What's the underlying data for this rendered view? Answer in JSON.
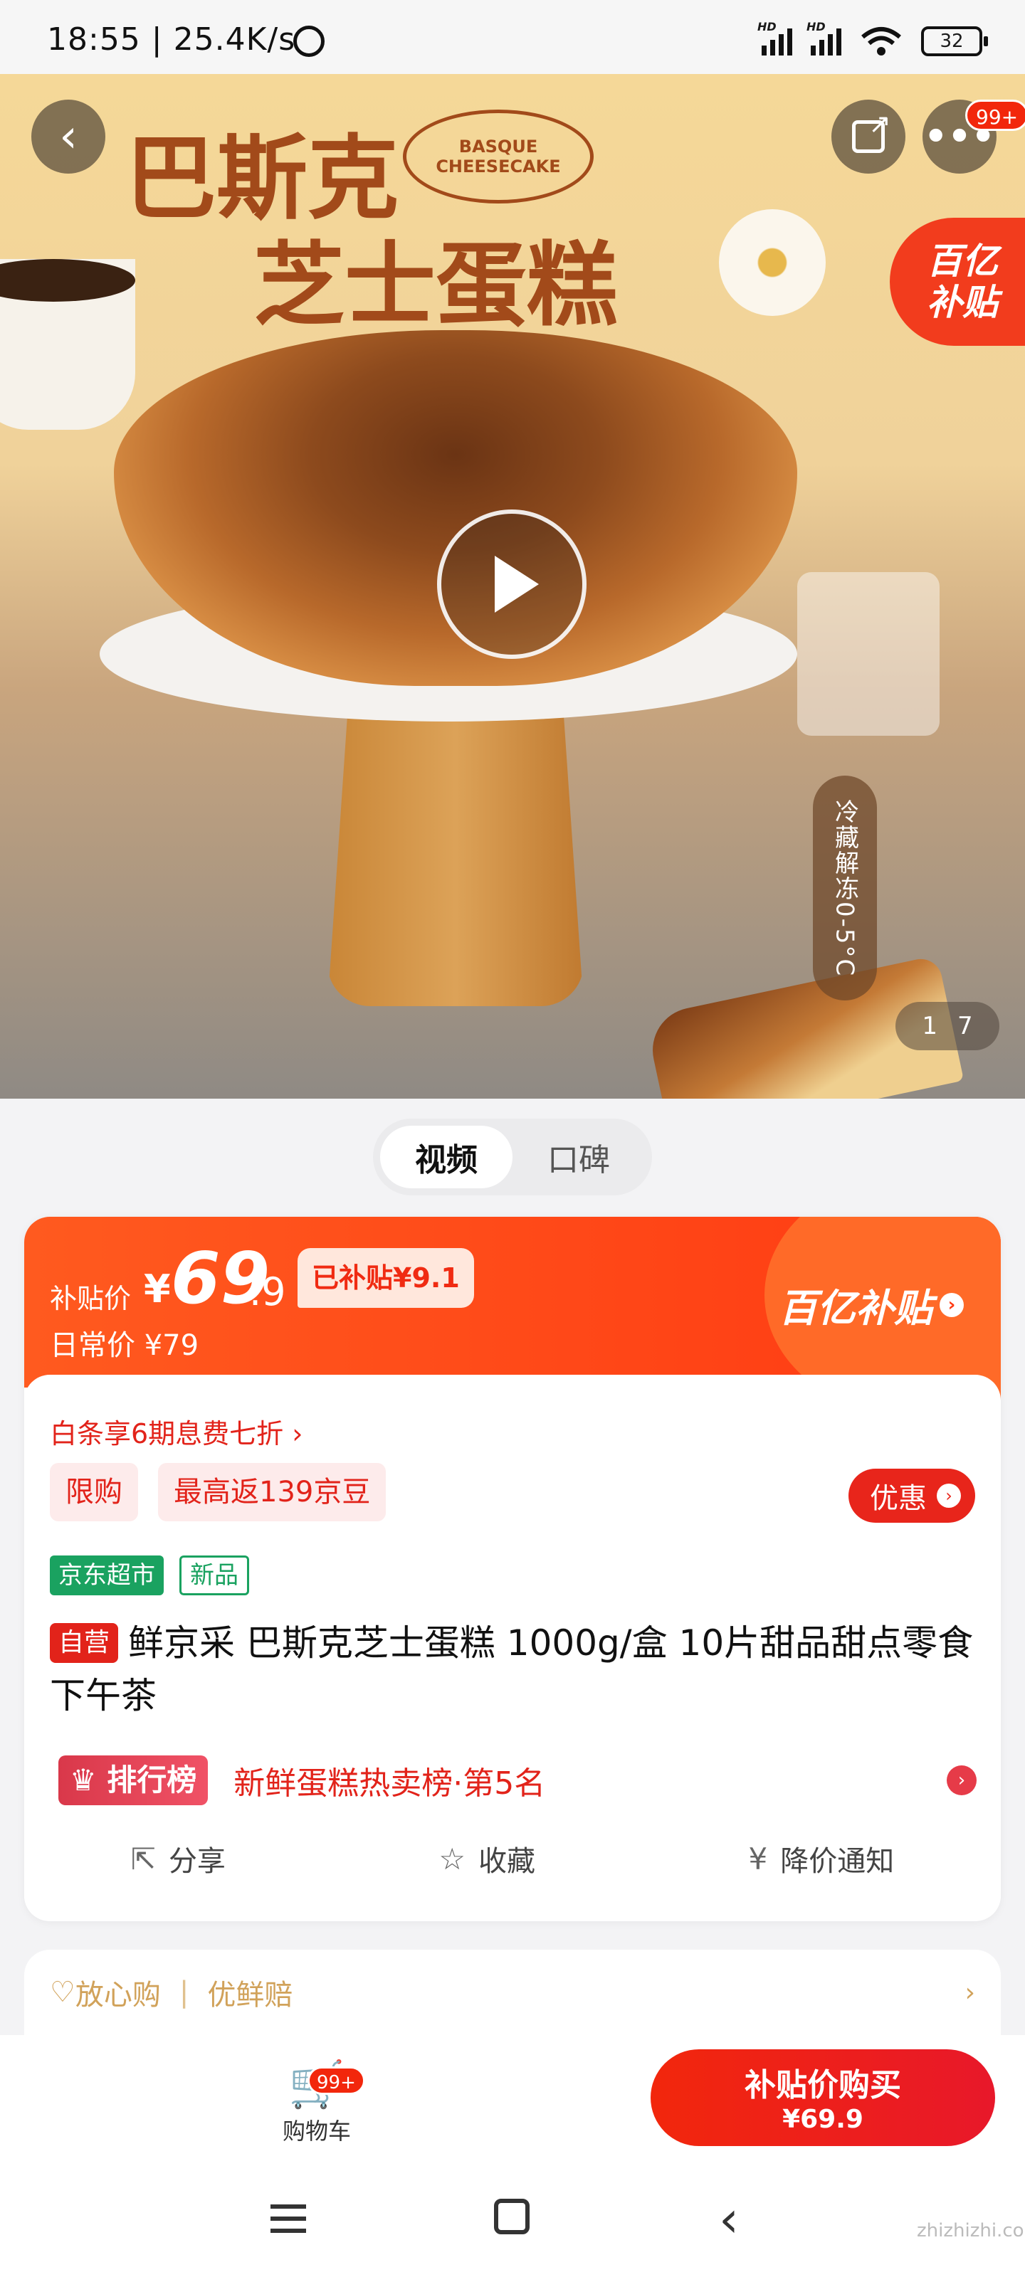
{
  "status_bar": {
    "time": "18:55 | 25.4K/s",
    "battery": "32",
    "hd1": "HD",
    "hd2": "HD"
  },
  "hero": {
    "title_line1": "巴斯克",
    "title_line2": "芝士蛋糕",
    "oval_text": "BASQUE CHEESECAKE",
    "subsidy_tag_l1": "百亿",
    "subsidy_tag_l2": "补贴",
    "temp_note": "冷藏解冻0-5°C",
    "page_current": "1",
    "page_total": "7",
    "more_badge": "99+",
    "icons": {
      "back": "chevron-left-icon",
      "share": "share-icon",
      "more": "more-icon",
      "play": "play-icon"
    }
  },
  "media_tabs": {
    "video": "视频",
    "reviews": "口碑"
  },
  "price": {
    "label": "补贴价",
    "yen": "¥",
    "integer": "69",
    "decimal": ".9",
    "subsidized": "已补贴¥9.1",
    "daily_price": "日常价 ¥79",
    "brand": "百亿补贴",
    "brand_arrow": "›"
  },
  "promo": {
    "baitiao": "白条享6期息费七折 ›",
    "chip1": "限购",
    "chip2": "最高返139京豆",
    "youhui": "优惠",
    "youhui_arrow": "›"
  },
  "tags": {
    "store": "京东超市",
    "new": "新品"
  },
  "product": {
    "ziying": "自营",
    "title": "鲜京采 巴斯克芝士蛋糕 1000g/盒 10片甜品甜点零食下午茶"
  },
  "rank": {
    "badge": "排行榜",
    "text": "新鲜蛋糕热卖榜·第5名",
    "arrow": "›"
  },
  "actions": {
    "share": "分享",
    "favorite": "收藏",
    "price_alert": "降价通知"
  },
  "guarantee": {
    "item1": "放心购",
    "sep": "|",
    "item2": "优鲜赔",
    "chevron": "›"
  },
  "bottom_bar": {
    "cart_label": "购物车",
    "cart_badge": "99+",
    "buy_line1": "补贴价购买",
    "buy_line2": "¥69.9"
  },
  "watermark": "zhizhizhi.com",
  "colors": {
    "primary_red": "#f2270c",
    "band_orange": "#ff5a1f",
    "green": "#1aa260",
    "gold": "#d1a25a"
  }
}
